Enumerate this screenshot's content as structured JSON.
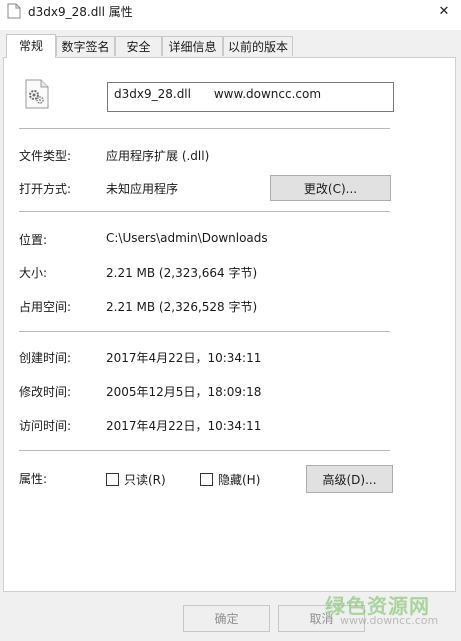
{
  "window": {
    "title": "d3dx9_28.dll 属性",
    "close_glyph": "✕"
  },
  "tabs": [
    {
      "label": "常规",
      "active": true
    },
    {
      "label": "数字签名",
      "active": false
    },
    {
      "label": "安全",
      "active": false
    },
    {
      "label": "详细信息",
      "active": false
    },
    {
      "label": "以前的版本",
      "active": false
    }
  ],
  "file": {
    "name_value": "d3dx9_28.dll      www.downcc.com",
    "icon": "dll-gear-file-icon"
  },
  "props": {
    "type_label": "文件类型:",
    "type_value": "应用程序扩展 (.dll)",
    "open_label": "打开方式:",
    "open_value": "未知应用程序",
    "change_button": "更改(C)...",
    "location_label": "位置:",
    "location_value": "C:\\Users\\admin\\Downloads",
    "size_label": "大小:",
    "size_value": "2.21 MB (2,323,664 字节)",
    "disk_label": "占用空间:",
    "disk_value": "2.21 MB (2,326,528 字节)",
    "created_label": "创建时间:",
    "created_value": "2017年4月22日，10:34:11",
    "modified_label": "修改时间:",
    "modified_value": "2005年12月5日，18:09:18",
    "accessed_label": "访问时间:",
    "accessed_value": "2017年4月22日，10:34:11",
    "attr_label": "属性:",
    "readonly_label": "只读(R)",
    "hidden_label": "隐藏(H)",
    "advanced_button": "高级(D)..."
  },
  "footer": {
    "ok": "确定",
    "cancel": "取消"
  },
  "watermark": {
    "text": "绿色资源网",
    "sub": "www.downcc.com"
  },
  "colors": {
    "panel": "#ffffff",
    "window": "#f0f0f0",
    "button": "#e1e1e1",
    "watermark": "#70be5a"
  }
}
